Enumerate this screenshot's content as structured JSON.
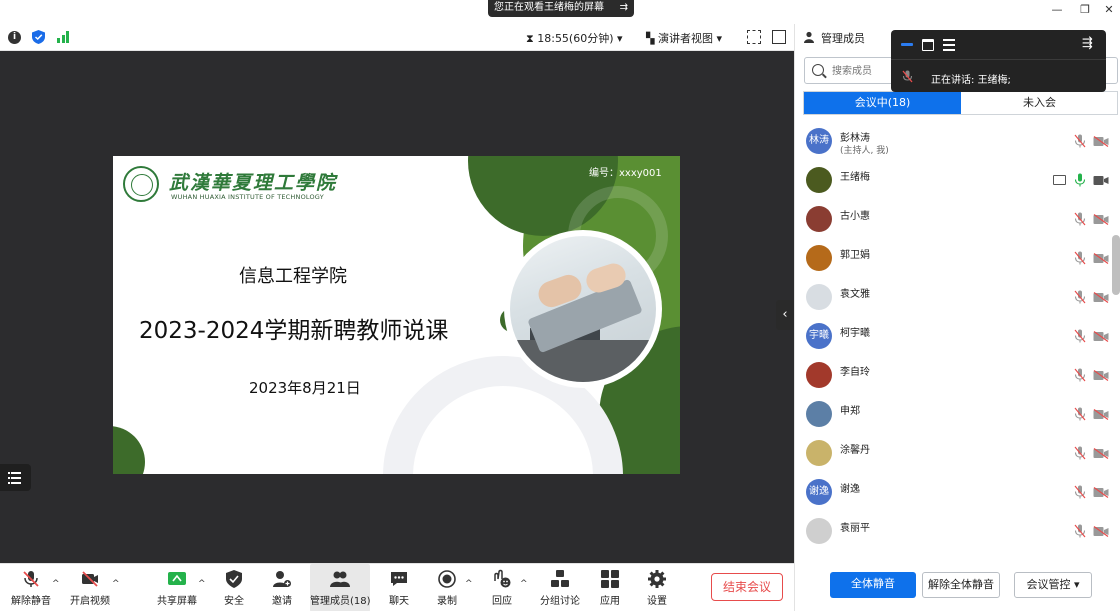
{
  "share_banner": {
    "text": "您正在观看王绪梅的屏幕"
  },
  "window_controls": {
    "minimize": "—",
    "restore": "❐",
    "close": "✕"
  },
  "toolbar": {
    "timer": "18:55(60分钟)",
    "view_mode": "演讲者视图"
  },
  "slide": {
    "school_cn": "武漢華夏理工學院",
    "school_en": "WUHAN HUAXIA INSTITUTE OF TECHNOLOGY",
    "code": "编号：xxxy001",
    "department": "信息工程学院",
    "title": "2023-2024学期新聘教师说课",
    "date": "2023年8月21日",
    "colors": {
      "dark_green": "#3d6b2a",
      "mid_green": "#5a8f33",
      "light_green": "#6aa03c"
    }
  },
  "bottombar": {
    "unmute": "解除静音",
    "start_video": "开启视频",
    "share_screen": "共享屏幕",
    "security": "安全",
    "invite": "邀请",
    "manage_members": "管理成员(18)",
    "chat": "聊天",
    "record": "录制",
    "reactions": "回应",
    "breakout": "分组讨论",
    "apps": "应用",
    "settings": "设置",
    "end_meeting": "结束会议"
  },
  "panel": {
    "title": "管理成员",
    "search_placeholder": "搜索成员",
    "tab_in_meeting": "会议中(18)",
    "tab_not_joined": "未入会",
    "members": [
      {
        "name": "彭林涛",
        "sub": "(主持人, 我)",
        "avatar_text": "林涛",
        "avatar_color": "#4a72c9",
        "mic": "off",
        "cam": "off"
      },
      {
        "name": "王绪梅",
        "sub": "",
        "avatar_text": "",
        "avatar_color": "#4b5a1f",
        "mic": "on",
        "cam": "on",
        "sharing": true
      },
      {
        "name": "古小惠",
        "sub": "",
        "avatar_text": "",
        "avatar_color": "#8a3d32",
        "mic": "off",
        "cam": "off"
      },
      {
        "name": "郭卫娟",
        "sub": "",
        "avatar_text": "",
        "avatar_color": "#b56a1a",
        "mic": "off",
        "cam": "off"
      },
      {
        "name": "袁文雅",
        "sub": "",
        "avatar_text": "",
        "avatar_color": "#d8dde2",
        "mic": "off",
        "cam": "off"
      },
      {
        "name": "柯宇曦",
        "sub": "",
        "avatar_text": "宇曦",
        "avatar_color": "#4a72c9",
        "mic": "off",
        "cam": "off"
      },
      {
        "name": "李自玲",
        "sub": "",
        "avatar_text": "",
        "avatar_color": "#a2392b",
        "mic": "off",
        "cam": "off"
      },
      {
        "name": "申郑",
        "sub": "",
        "avatar_text": "",
        "avatar_color": "#5c7fa6",
        "mic": "off",
        "cam": "off"
      },
      {
        "name": "涂馨丹",
        "sub": "",
        "avatar_text": "",
        "avatar_color": "#c9b36a",
        "mic": "off",
        "cam": "off"
      },
      {
        "name": "谢逸",
        "sub": "",
        "avatar_text": "谢逸",
        "avatar_color": "#4a72c9",
        "mic": "off",
        "cam": "off"
      },
      {
        "name": "袁丽平",
        "sub": "",
        "avatar_text": "",
        "avatar_color": "#cfcfcf",
        "mic": "off",
        "cam": "off"
      }
    ],
    "mute_all": "全体静音",
    "unmute_all": "解除全体静音",
    "meeting_control": "会议管控"
  },
  "float": {
    "speaking_label": "正在讲话:",
    "speaking_name": "王绪梅;"
  }
}
